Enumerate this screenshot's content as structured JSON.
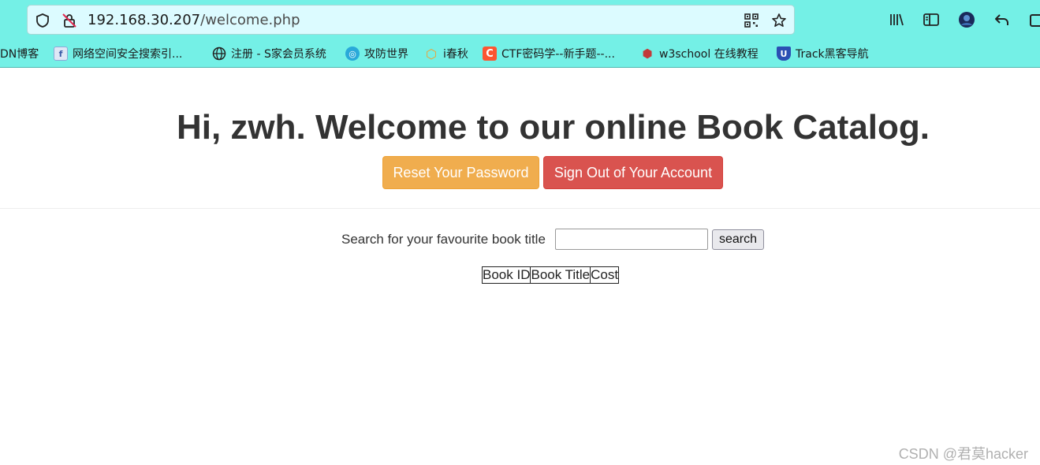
{
  "browser": {
    "url_host": "192.168.30.207",
    "url_path": "/welcome.php",
    "chrome_color": "#74f0e6",
    "nav_icons": [
      "shield-icon",
      "lock-strikethrough-icon",
      "qr-code-icon",
      "star-icon",
      "library-icon",
      "sidebar-icon",
      "profile-icon",
      "back-icon",
      "extension-icon"
    ]
  },
  "bookmarks": [
    {
      "label": "DN博客",
      "icon": "csdn-icon",
      "color": ""
    },
    {
      "label": "网络空间安全搜索引...",
      "icon": "fofa-icon",
      "color": "#8fa8d8"
    },
    {
      "label": "注册 - S家会员系统",
      "icon": "globe-icon",
      "color": ""
    },
    {
      "label": "攻防世界",
      "icon": "adworld-icon",
      "color": "#29a9d9"
    },
    {
      "label": "i春秋",
      "icon": "ichunqiu-icon",
      "color": "#f0a030"
    },
    {
      "label": "CTF密码学--新手题--...",
      "icon": "csdn-c-icon",
      "color": "#fc5531"
    },
    {
      "label": "w3school 在线教程",
      "icon": "w3school-icon",
      "color": "#c23a3a"
    },
    {
      "label": "Track黑客导航",
      "icon": "track-icon",
      "color": "#2b4fb3"
    }
  ],
  "page": {
    "greeting_prefix": "Hi, ",
    "username": "zwh",
    "greeting_suffix": ". Welcome to our online Book Catalog.",
    "reset_button": "Reset Your Password",
    "signout_button": "Sign Out of Your Account",
    "search_label": "Search for your favourite book title",
    "search_value": "",
    "search_button": "search",
    "table_headers": [
      "Book ID",
      "Book Title",
      "Cost"
    ]
  },
  "watermark": "CSDN @君莫hacker"
}
